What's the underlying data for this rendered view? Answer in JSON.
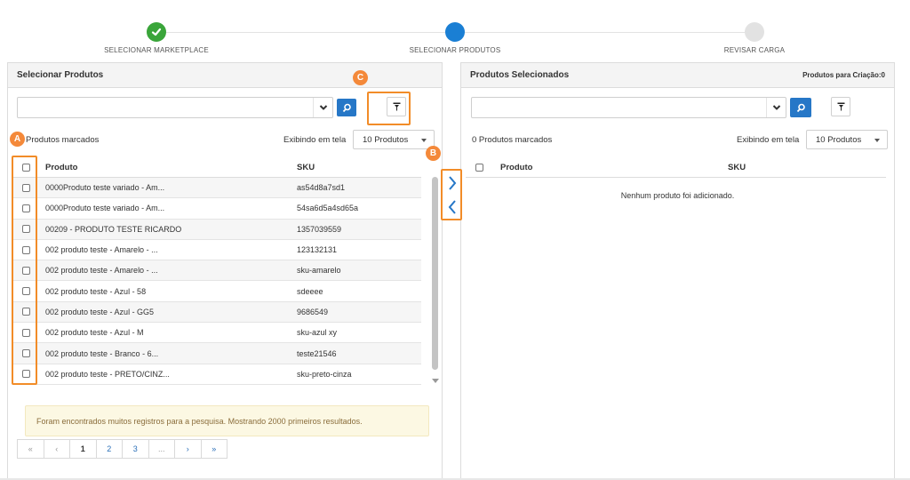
{
  "stepper": {
    "steps": [
      {
        "label": "SELECIONAR MARKETPLACE",
        "state": "done"
      },
      {
        "label": "SELECIONAR PRODUTOS",
        "state": "active"
      },
      {
        "label": "REVISAR CARGA",
        "state": "todo"
      }
    ],
    "colors": {
      "done": "#3aa53a",
      "active": "#1a7fd4",
      "todo": "#e2e2e2"
    }
  },
  "left": {
    "title": "Selecionar Produtos",
    "search": {
      "value": "",
      "placeholder": ""
    },
    "marked_text": "Produtos marcados",
    "show_label": "Exibindo em tela",
    "page_size": "10 Produtos",
    "columns": {
      "product": "Produto",
      "sku": "SKU"
    },
    "rows": [
      {
        "product": "0000Produto teste variado - Am...",
        "sku": "as54d8a7sd1"
      },
      {
        "product": "0000Produto teste variado - Am...",
        "sku": "54sa6d5a4sd65a"
      },
      {
        "product": "00209 - PRODUTO TESTE RICARDO",
        "sku": "1357039559"
      },
      {
        "product": "002 produto teste - Amarelo - ...",
        "sku": "123132131"
      },
      {
        "product": "002 produto teste - Amarelo - ...",
        "sku": "sku-amarelo"
      },
      {
        "product": "002 produto teste - Azul - 58",
        "sku": "sdeeee"
      },
      {
        "product": "002 produto teste - Azul - GG5",
        "sku": "9686549"
      },
      {
        "product": "002 produto teste - Azul - M",
        "sku": "sku-azul xy"
      },
      {
        "product": "002 produto teste - Branco - 6...",
        "sku": "teste21546"
      },
      {
        "product": "002 produto teste - PRETO/CINZ...",
        "sku": "sku-preto-cinza"
      }
    ],
    "alert": "Foram encontrados muitos registros para a pesquisa. Mostrando 2000 primeiros resultados.",
    "pagination": [
      "«",
      "‹",
      "1",
      "2",
      "3",
      "...",
      "›",
      "»"
    ]
  },
  "right": {
    "title": "Produtos Selecionados",
    "creation_count": "Produtos para Criação:0",
    "search": {
      "value": "",
      "placeholder": ""
    },
    "marked_text": "0 Produtos marcados",
    "show_label": "Exibindo em tela",
    "page_size": "10 Produtos",
    "columns": {
      "product": "Produto",
      "sku": "SKU"
    },
    "empty": "Nenhum produto foi adicionado."
  },
  "annotations": {
    "a": "A",
    "b": "B",
    "c": "C",
    "color": "#f28c28"
  },
  "icons": [
    "check-icon",
    "chevron-down-icon",
    "search-icon",
    "filter-icon",
    "chevron-right-icon",
    "chevron-left-icon"
  ]
}
